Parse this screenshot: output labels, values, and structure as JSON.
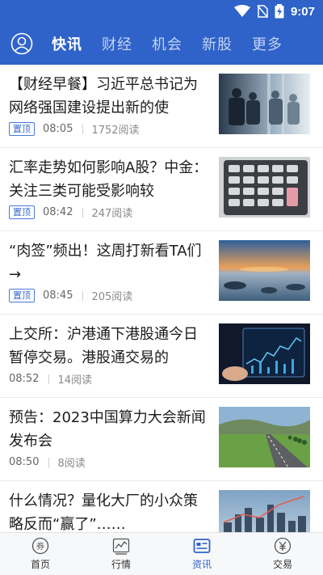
{
  "status_bar": {
    "time": "9:07"
  },
  "header": {
    "tabs": [
      {
        "label": "快讯",
        "active": true
      },
      {
        "label": "财经",
        "active": false
      },
      {
        "label": "机会",
        "active": false
      },
      {
        "label": "新股",
        "active": false
      },
      {
        "label": "更多",
        "active": false
      }
    ]
  },
  "articles": [
    {
      "title": "【财经早餐】习近平总书记为网络强国建设提出新的使",
      "badge": "置顶",
      "time": "08:05",
      "reads": "1752阅读",
      "image": "business-people-photo"
    },
    {
      "title": "汇率走势如何影响A股？中金：关注三类可能受影响较",
      "badge": "置顶",
      "time": "08:42",
      "reads": "247阅读",
      "image": "calculator-photo"
    },
    {
      "title": "“肉签”频出！这周打新看TA们→",
      "badge": "置顶",
      "time": "08:45",
      "reads": "205阅读",
      "image": "sunset-sea-photo"
    },
    {
      "title": "上交所：沪港通下港股通今日暂停交易。港股通交易的",
      "badge": "",
      "time": "08:52",
      "reads": "14阅读",
      "image": "stock-chart-tablet-photo"
    },
    {
      "title": "预告：2023中国算力大会新闻发布会",
      "badge": "",
      "time": "08:50",
      "reads": "8阅读",
      "image": "country-road-photo"
    },
    {
      "title": "什么情况？量化大厂的小众策略反而“赢了”……",
      "badge": "",
      "time": "",
      "reads": "",
      "image": "city-skyline-photo"
    }
  ],
  "bottom_nav": [
    {
      "label": "首页",
      "icon": "coupon-icon",
      "active": false
    },
    {
      "label": "行情",
      "icon": "market-chart-icon",
      "active": false
    },
    {
      "label": "资讯",
      "icon": "news-icon",
      "active": true
    },
    {
      "label": "交易",
      "icon": "yuan-icon",
      "active": false
    }
  ],
  "colors": {
    "primary": "#2f63c9",
    "badge": "#3b6ad0",
    "active_nav": "#2f63c9"
  }
}
